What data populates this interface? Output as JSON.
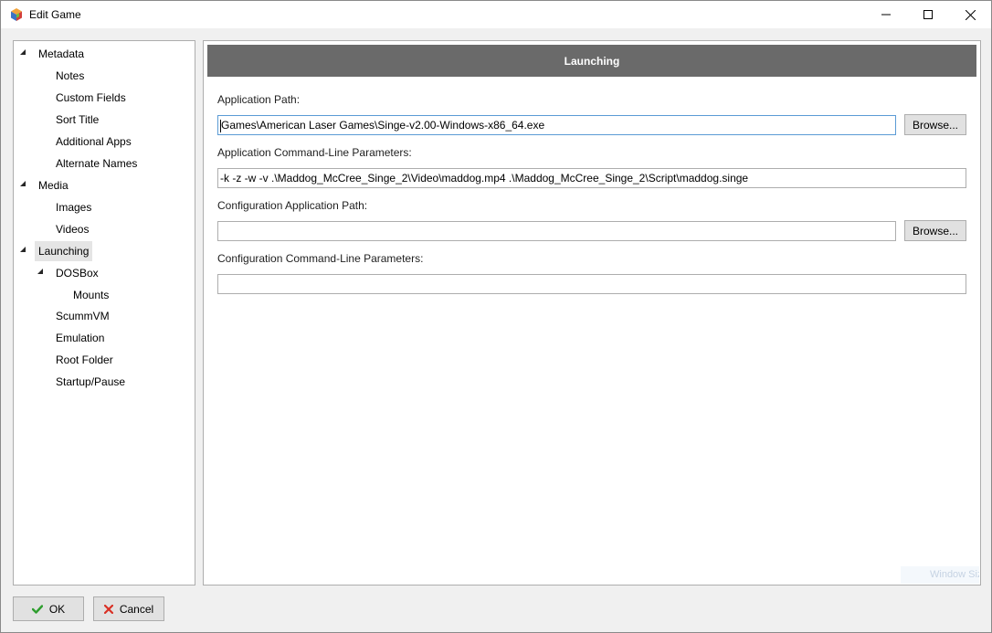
{
  "window": {
    "title": "Edit Game",
    "controls": {
      "minimize": "minimize-icon",
      "maximize": "maximize-icon",
      "close": "close-icon"
    }
  },
  "nav": {
    "metadata": "Metadata",
    "notes": "Notes",
    "custom_fields": "Custom Fields",
    "sort_title": "Sort Title",
    "additional_apps": "Additional Apps",
    "alternate_names": "Alternate Names",
    "media": "Media",
    "images": "Images",
    "videos": "Videos",
    "launching": "Launching",
    "dosbox": "DOSBox",
    "mounts": "Mounts",
    "scummvm": "ScummVM",
    "emulation": "Emulation",
    "root_folder": "Root Folder",
    "startup_pause": "Startup/Pause",
    "selected": "Launching"
  },
  "panel": {
    "header": "Launching",
    "application_path_label": "Application Path:",
    "application_path_value": "Games\\American Laser Games\\Singe-v2.00-Windows-x86_64.exe",
    "application_params_label": "Application Command-Line Parameters:",
    "application_params_value": "-k -z -w -v .\\Maddog_McCree_Singe_2\\Video\\maddog.mp4 .\\Maddog_McCree_Singe_2\\Script\\maddog.singe",
    "config_path_label": "Configuration Application Path:",
    "config_path_value": "",
    "config_params_label": "Configuration Command-Line Parameters:",
    "config_params_value": "",
    "browse_label": "Browse..."
  },
  "watermark": "Window Size",
  "footer": {
    "ok_label": "OK",
    "cancel_label": "Cancel"
  },
  "colors": {
    "header_bar": "#6a6a6a",
    "ok_check": "#2e9e2e",
    "cancel_x": "#d93025",
    "focus_border": "#5b9bd5"
  }
}
